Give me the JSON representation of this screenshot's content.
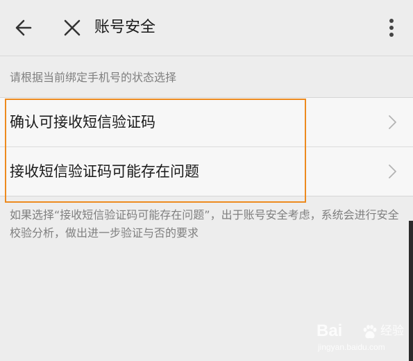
{
  "header": {
    "title": "账号安全",
    "back_icon": "arrow-left-icon",
    "close_icon": "close-icon",
    "more_icon": "more-vertical-icon"
  },
  "hint": "请根据当前绑定手机号的状态选择",
  "options": [
    {
      "label": "确认可接收短信验证码",
      "icon": "chevron-right-icon"
    },
    {
      "label": "接收短信验证码可能存在问题",
      "icon": "chevron-right-icon"
    }
  ],
  "note": "如果选择“接收短信验证码可能存在问题”，出于账号安全考虑，系统会进行安全校验分析，做出进一步验证与否的要求",
  "watermark": {
    "brand": "Bai",
    "jingyan": "经验",
    "url": "jingyan.baidu.com"
  },
  "colors": {
    "background": "#ededed",
    "list_background": "#f7f7f7",
    "highlight": "#ed8a1e",
    "secondary_text": "#7f7f7f"
  }
}
